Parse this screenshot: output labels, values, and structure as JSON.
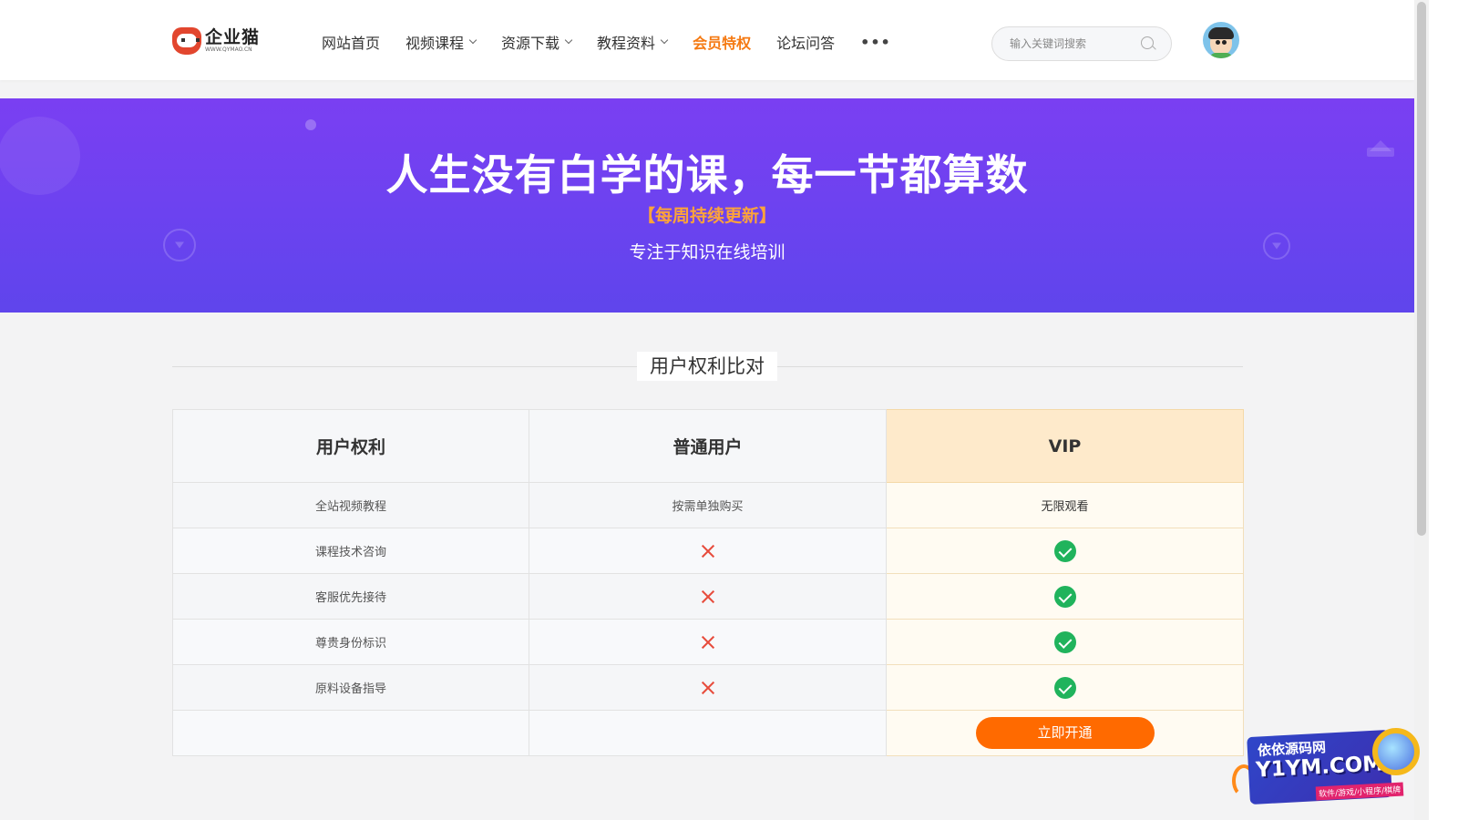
{
  "header": {
    "logo": {
      "name": "企业猫",
      "url": "WWW.QYMAO.CN"
    },
    "nav": [
      {
        "label": "网站首页",
        "dropdown": false,
        "active": false
      },
      {
        "label": "视频课程",
        "dropdown": true,
        "active": false
      },
      {
        "label": "资源下载",
        "dropdown": true,
        "active": false
      },
      {
        "label": "教程资料",
        "dropdown": true,
        "active": false
      },
      {
        "label": "会员特权",
        "dropdown": false,
        "active": true
      },
      {
        "label": "论坛问答",
        "dropdown": false,
        "active": false
      }
    ],
    "more_label": "•••",
    "search": {
      "placeholder": "输入关键词搜索",
      "value": ""
    }
  },
  "banner": {
    "title": "人生没有白学的课，每一节都算数",
    "subtitle": "【每周持续更新】",
    "tagline": "专注于知识在线培训"
  },
  "section": {
    "title": "用户权利比对"
  },
  "table": {
    "headers": [
      "用户权利",
      "普通用户",
      "VIP"
    ],
    "rows": [
      {
        "feature": "全站视频教程",
        "normal": {
          "type": "text",
          "text": "按需单独购买"
        },
        "vip": {
          "type": "text",
          "text": "无限观看"
        }
      },
      {
        "feature": "课程技术咨询",
        "normal": {
          "type": "cross"
        },
        "vip": {
          "type": "check"
        }
      },
      {
        "feature": "客服优先接待",
        "normal": {
          "type": "cross"
        },
        "vip": {
          "type": "check"
        }
      },
      {
        "feature": "尊贵身份标识",
        "normal": {
          "type": "cross"
        },
        "vip": {
          "type": "check"
        }
      },
      {
        "feature": "原料设备指导",
        "normal": {
          "type": "cross"
        },
        "vip": {
          "type": "check"
        }
      }
    ],
    "cta_label": "立即开通"
  },
  "watermark": {
    "line1": "依依源码网",
    "line2": "Y1YM.COM",
    "line3": "软件/游戏/小程序/棋牌"
  },
  "colors": {
    "accent_orange": "#f57a13",
    "banner_purple": "#6d42f0",
    "cta_orange": "#ff6a00",
    "vip_header": "#feeacb",
    "check_green": "#20b35c",
    "cross_red": "#e74c3c"
  }
}
